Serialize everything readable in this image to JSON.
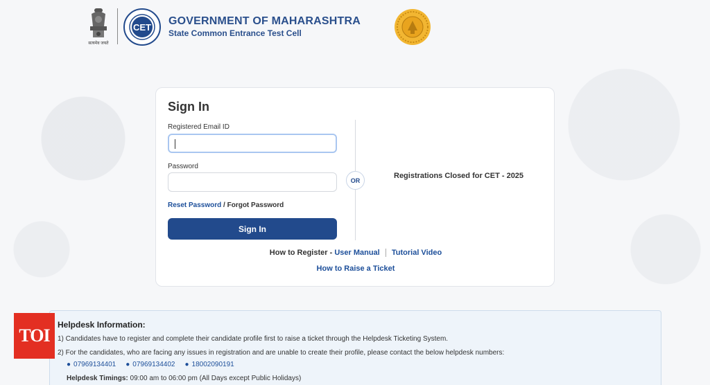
{
  "header": {
    "emblem_caption": "सत्यमेव जयते",
    "title": "GOVERNMENT OF MAHARASHTRA",
    "subtitle": "State Common Entrance Test Cell",
    "cet_logo_text": "CET"
  },
  "signin": {
    "title": "Sign In",
    "email_label": "Registered Email ID",
    "email_value": "",
    "password_label": "Password",
    "password_value": "",
    "reset_link": "Reset Password",
    "reset_separator": " / ",
    "forgot_text": "Forgot Password",
    "button_label": "Sign In",
    "or_label": "OR",
    "closed_message": "Registrations Closed for CET - 2025",
    "how_to_register": "How to Register - ",
    "user_manual": "User Manual",
    "tutorial_video": "Tutorial Video",
    "raise_ticket": "How to Raise a Ticket"
  },
  "helpdesk": {
    "title": "Helpdesk Information:",
    "line1": "1)  Candidates have to register and complete their candidate profile first to raise a ticket through the Helpdesk Ticketing System.",
    "line2": "2)  For the candidates, who are facing any issues in registration and are unable to create their profile, please contact the below helpdesk numbers:",
    "phones": [
      "07969134401",
      "07969134402",
      "18002090191"
    ],
    "timings_label": "Helpdesk Timings:",
    "timings_value": " 09:00 am to 06:00 pm (All Days except Public Holidays)"
  },
  "watermark": {
    "toi": "TOI"
  },
  "colors": {
    "brand_blue": "#224a8c",
    "link_blue": "#1d4f9a",
    "toi_red": "#e32f22"
  }
}
